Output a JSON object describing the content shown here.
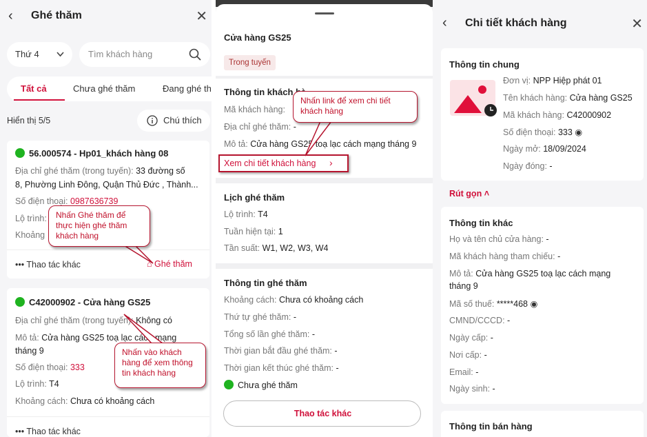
{
  "left": {
    "title": "Ghé thăm",
    "day_select": "Thứ 4",
    "search_placeholder": "Tìm khách hàng",
    "tabs": [
      "Tất cả",
      "Chưa ghé thăm",
      "Đang ghé th"
    ],
    "count": "Hiển thị 5/5",
    "legend_button": "Chú thích",
    "card1": {
      "title": "56.000574 - Hp01_khách hàng 08",
      "addr_label": "Địa chỉ ghé thăm (trong tuyến):",
      "addr_value": "33 đường số",
      "addr_line2": "8, Phường Linh Đông, Quận Thủ Đức , Thành...",
      "phone_label": "Số điện thoại:",
      "phone_value": "0987636739",
      "route_label": "Lộ trình:",
      "dist_label": "Khoảng",
      "more": "Thao tác khác",
      "visit": "Ghé thăm"
    },
    "card2": {
      "title": "C42000902 - Cửa hàng GS25",
      "addr_label": "Địa chỉ ghé thăm (trong tuyến):",
      "addr_value": "Không có",
      "desc_label": "Mô tả:",
      "desc_value": "Cửa hàng GS25 toạ lạc cách mạng",
      "desc_line2": "tháng 9",
      "phone_label": "Số điện thoại:",
      "phone_value": "333",
      "route_label": "Lộ trình:",
      "route_value": "T4",
      "dist_label": "Khoảng cách:",
      "dist_value": "Chưa có khoảng cách",
      "more": "Thao tác khác"
    },
    "callout_visit": "Nhấn Ghé thăm để thực hiện ghé thăm khách hàng",
    "callout_customer": "Nhấn vào khách hàng để xem thông tin khách hàng"
  },
  "middle": {
    "store": "Cửa hàng GS25",
    "status_badge": "Trong tuyến",
    "info_title": "Thông tin khách hà",
    "code_label": "Mã khách hàng:",
    "addr_label": "Địa chỉ ghé thăm:",
    "addr_value": "-",
    "desc_label": "Mô tả:",
    "desc_value": "Cửa hàng GS25 toạ lạc cách mạng tháng 9",
    "detail_link": "Xem chi tiết khách hàng",
    "callout_link": "Nhấn link để xem chi tiết khách hàng",
    "schedule_title": "Lịch ghé thăm",
    "route_label": "Lộ trình:",
    "route_value": "T4",
    "week_label": "Tuần hiện tại:",
    "week_value": "1",
    "freq_label": "Tần suất:",
    "freq_value": "W1, W2, W3, W4",
    "visit_title": "Thông tin ghé thăm",
    "dist_label": "Khoảng cách:",
    "dist_value": "Chưa có khoảng cách",
    "order_label": "Thứ tự ghé thăm:",
    "order_value": "-",
    "total_label": "Tổng số lần ghé thăm:",
    "total_value": "-",
    "start_label": "Thời gian bắt đầu ghé thăm:",
    "start_value": "-",
    "end_label": "Thời gian kết thúc ghé thăm:",
    "end_value": "-",
    "visit_status": "Chưa ghé thăm",
    "more_button": "Thao tác khác"
  },
  "right": {
    "title": "Chi tiết khách hàng",
    "general_title": "Thông tin chung",
    "unit_label": "Đơn vị:",
    "unit_value": "NPP Hiệp phát 01",
    "name_label": "Tên khách hàng:",
    "name_value": "Cửa hàng GS25",
    "code_label": "Mã khách hàng:",
    "code_value": "C42000902",
    "phone_label": "Số điện thoại:",
    "phone_value": "333",
    "open_label": "Ngày mở:",
    "open_value": "18/09/2024",
    "close_label": "Ngày đóng:",
    "close_value": "-",
    "collapse": "Rút gọn",
    "other_title": "Thông tin khác",
    "owner_label": "Họ và tên chủ cửa hàng:",
    "owner_value": "-",
    "ref_label": "Mã khách hàng tham chiếu:",
    "ref_value": "-",
    "desc_label": "Mô tả:",
    "desc_value": "Cửa hàng GS25 toạ lạc cách mạng",
    "desc_line2": "tháng 9",
    "tax_label": "Mã số thuế:",
    "tax_value": "*****468",
    "id_label": "CMND/CCCD:",
    "id_value": "-",
    "issue_label": "Ngày cấp:",
    "issue_value": "-",
    "place_label": "Nơi cấp:",
    "place_value": "-",
    "email_label": "Email:",
    "email_value": "-",
    "dob_label": "Ngày sinh:",
    "dob_value": "-",
    "sales_title": "Thông tin bán hàng"
  },
  "colors": {
    "accent": "#d0103a",
    "green": "#1fb320"
  }
}
